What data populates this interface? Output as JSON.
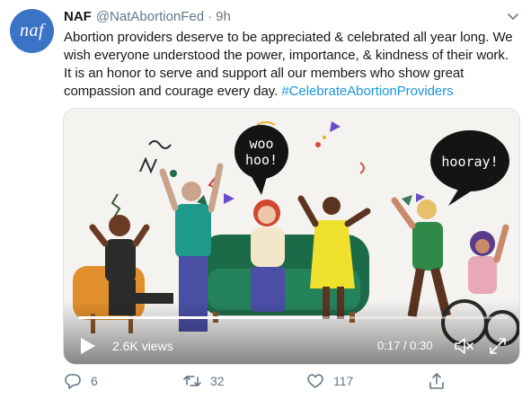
{
  "tweet": {
    "avatar_text": "naf",
    "display_name": "NAF",
    "handle": "@NatAbortionFed",
    "separator": "·",
    "time": "9h",
    "text_main": "Abortion providers deserve to be appreciated & celebrated all year long. We wish everyone understood the power, importance, & kindness of their work. It is an honor to serve and support all our members who show great compassion and courage every day. ",
    "hashtag": "#CelebrateAbortionProviders"
  },
  "media": {
    "bubble_1": [
      "woo",
      "hoo!"
    ],
    "bubble_2": "hooray!",
    "views": "2.6K views",
    "time_readout": "0:17 / 0:30",
    "progress_fraction": 0.567
  },
  "actions": {
    "reply_count": "6",
    "retweet_count": "32",
    "like_count": "117"
  },
  "colors": {
    "link": "#1b95e0",
    "muted": "#657786",
    "avatar_bg": "#3b73c7"
  },
  "icons": [
    "chevron-down-icon",
    "play-icon",
    "volume-mute-icon",
    "fullscreen-icon",
    "reply-icon",
    "retweet-icon",
    "like-icon",
    "share-icon"
  ]
}
